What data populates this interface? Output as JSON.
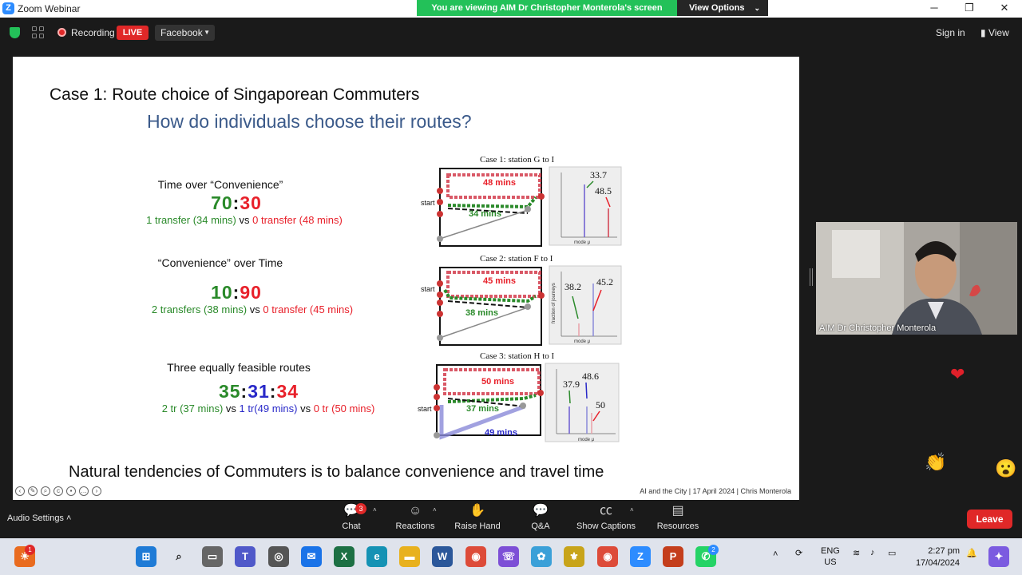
{
  "window": {
    "app_title": "Zoom Webinar",
    "viewing_banner": "You are viewing AIM Dr Christopher Monterola's screen",
    "view_options": "View Options",
    "minimize": "─",
    "restore": "❐",
    "close": "✕"
  },
  "topbar": {
    "recording_label": "Recording",
    "live_label": "LIVE",
    "stream_target": "Facebook",
    "signin_label": "Sign in",
    "view_label": "View"
  },
  "slide": {
    "title": "Case 1: Route choice of Singaporean Commuters",
    "subtitle": "How do individuals choose their routes?",
    "cases": [
      {
        "heading": "Time over “Convenience”",
        "ratio": [
          "70",
          ":",
          "30"
        ],
        "detail": [
          "1 transfer (34 mins)",
          " vs ",
          "0 transfer (48 mins)"
        ],
        "diagram": {
          "title": "Case 1: station G to I",
          "start_label": "start",
          "routes": [
            "48 mins",
            "34 mins"
          ],
          "peaks": [
            "33.7",
            "48.5"
          ],
          "axis_label": "mode μ"
        }
      },
      {
        "heading": "“Convenience” over Time",
        "ratio": [
          "10",
          ":",
          "90"
        ],
        "detail": [
          "2 transfers (38 mins)",
          " vs ",
          "0 transfer (45 mins)"
        ],
        "diagram": {
          "title": "Case 2: station F to I",
          "start_label": "start",
          "routes": [
            "45 mins",
            "38 mins"
          ],
          "peaks": [
            "38.2",
            "45.2"
          ],
          "axis_label": "mode μ",
          "y_label": "fraction of journeys"
        }
      },
      {
        "heading": "Three equally feasible routes",
        "ratio": [
          "35",
          ":",
          "31",
          ":",
          "34"
        ],
        "detail": [
          "2 tr (37 mins)",
          " vs ",
          "1 tr(49 mins)",
          " vs ",
          "0 tr (50 mins)"
        ],
        "diagram": {
          "title": "Case 3: station H to I",
          "start_label": "start",
          "routes": [
            "50 mins",
            "37 mins",
            "49 mins"
          ],
          "peaks": [
            "37.9",
            "48.6",
            "50"
          ],
          "axis_label": "mode μ"
        }
      }
    ],
    "bottom_line": "Natural tendencies of Commuters is to balance convenience and travel time",
    "footer": "AI and the City  |  17 April 2024  |   Chris Monterola"
  },
  "speaker": {
    "name": "AIM Dr Christopher Monterola"
  },
  "toolbar": {
    "audio_settings": "Audio Settings",
    "chat_label": "Chat",
    "chat_badge": "3",
    "reactions_label": "Reactions",
    "raise_hand_label": "Raise Hand",
    "qa_label": "Q&A",
    "captions_label": "Show Captions",
    "resources_label": "Resources",
    "leave_label": "Leave"
  },
  "taskbar": {
    "language": "ENG",
    "region": "US",
    "time": "2:27 pm",
    "date": "17/04/2024",
    "whatsapp_badge": "2",
    "widget_badge": "1"
  },
  "colors": {
    "green": "#2a8a2a",
    "red": "#e8202a",
    "blue": "#2828c8",
    "zoom_blue": "#2d8cff",
    "banner_green": "#23c159",
    "leave_red": "#e02828"
  }
}
